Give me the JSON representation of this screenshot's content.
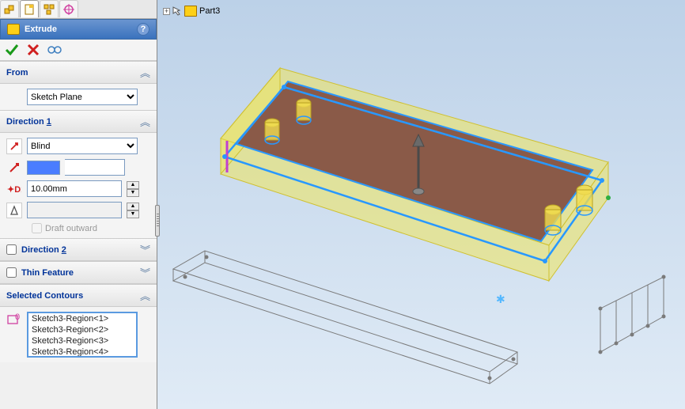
{
  "tabs_icons": [
    "feature",
    "property",
    "config",
    "display"
  ],
  "part_label": "Part3",
  "panel": {
    "title": "Extrude"
  },
  "from": {
    "header": "From",
    "plane": "Sketch Plane"
  },
  "direction1": {
    "header": "Direction 1",
    "end_condition": "Blind",
    "depth": "10.00mm",
    "draft_outward": "Draft outward"
  },
  "direction2": {
    "header": "Direction 2"
  },
  "thin_feature": {
    "header": "Thin Feature"
  },
  "selected_contours": {
    "header": "Selected Contours",
    "items": [
      "Sketch3-Region<1>",
      "Sketch3-Region<2>",
      "Sketch3-Region<3>",
      "Sketch3-Region<4>"
    ]
  }
}
